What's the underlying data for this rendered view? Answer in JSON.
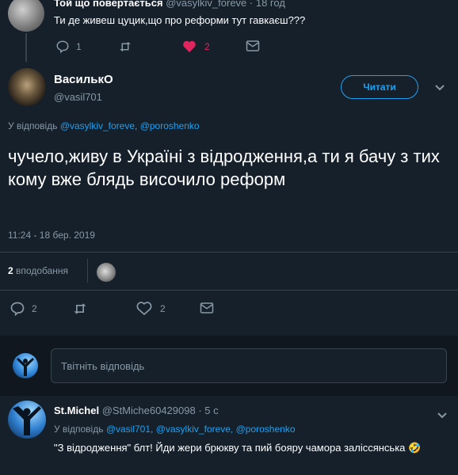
{
  "prev_tweet": {
    "display_name": "Той що повертається",
    "handle": "@vasylkiv_foreve",
    "time": "· 18 год",
    "text": "Ти де живеш цуцик,що про реформи тут гавкаєш???",
    "reply_count": "1",
    "retweet_count": "",
    "like_count": "2",
    "like_color": "#e0245e"
  },
  "main_tweet": {
    "display_name": "ВасилькО",
    "handle": "@vasil701",
    "follow_label": "Читати",
    "reply_prefix": "У відповідь",
    "mention1": "@vasylkiv_foreve",
    "mention2": "@poroshenko",
    "text": "чучело,живу в Україні з відродження,а ти я бачу з тих кому вже блядь височило реформ",
    "timestamp": "11:24 - 18 бер. 2019",
    "likes_number": "2",
    "likes_label": "вподобання",
    "reply_count": "2",
    "like_count": "2"
  },
  "reply_box": {
    "placeholder": "Твітніть відповідь"
  },
  "reply_tweet": {
    "display_name": "St.Michel",
    "handle": "@StMiche60429098",
    "time": "· 5 с",
    "reply_prefix": "У відповідь",
    "mention1": "@vasil701,",
    "mention2": "@vasylkiv_foreve,",
    "mention3": "@poroshenko",
    "text": "\"З відродження\" блт! Йди жери брюкву та пий бояру чамора заліссянська 🤣"
  },
  "colors": {
    "background": "#15202b",
    "accent": "#1da1f2",
    "muted": "#8899a6",
    "divider": "#38444d"
  }
}
